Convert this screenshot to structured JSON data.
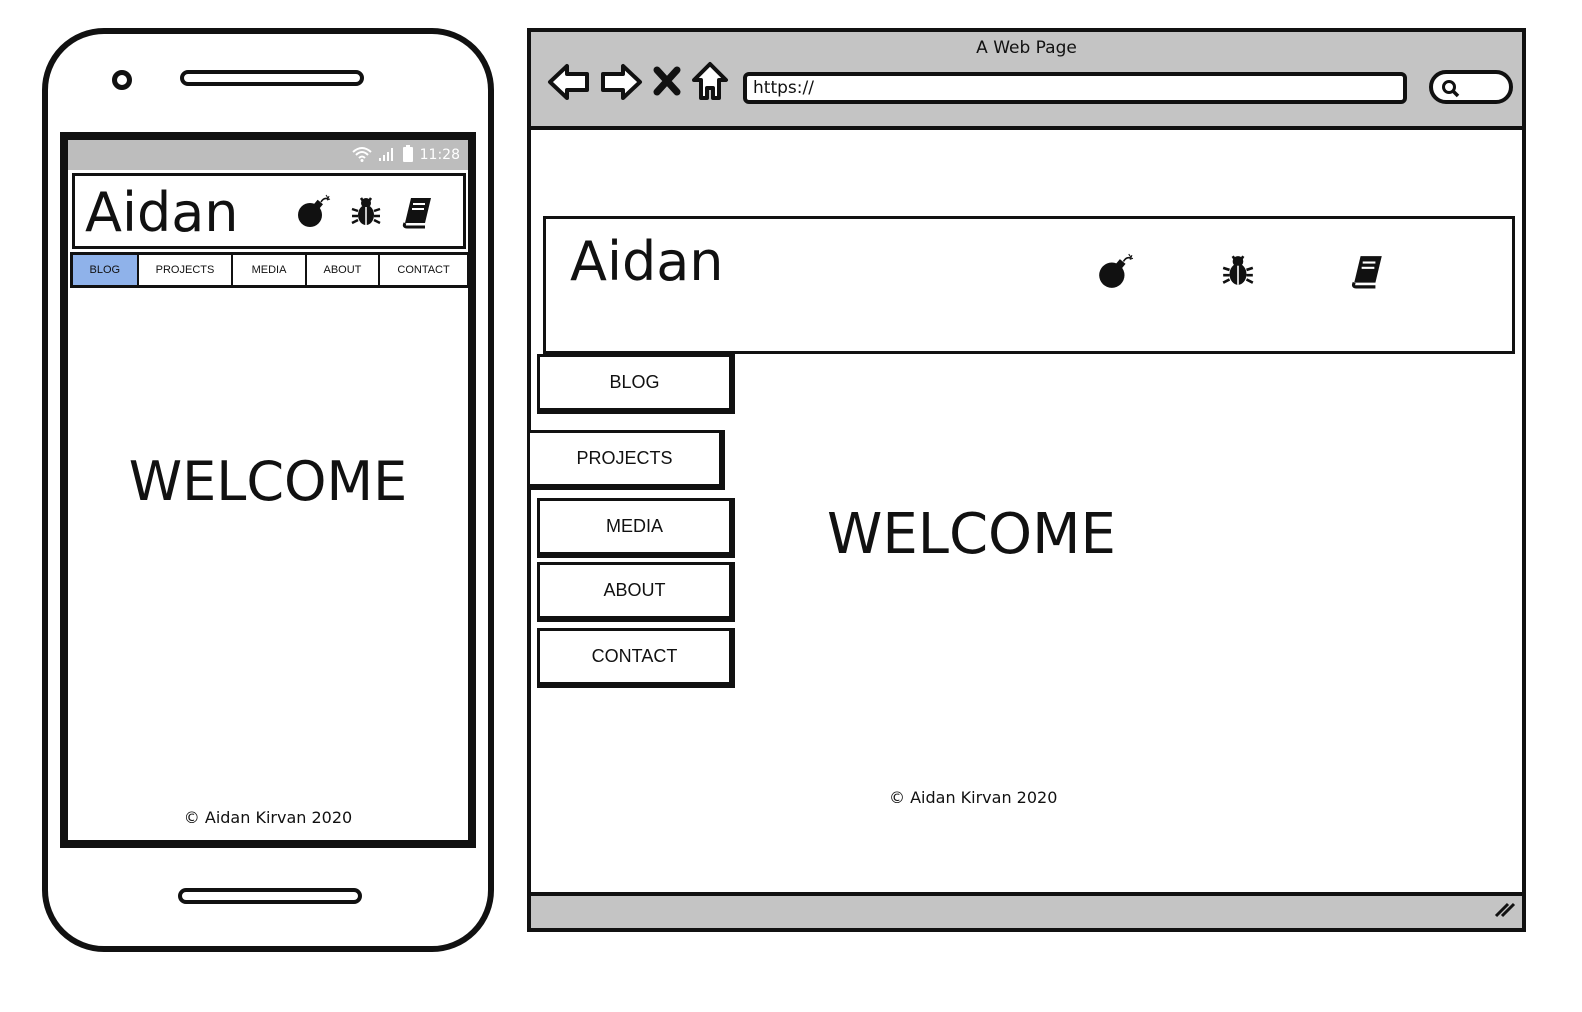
{
  "mobile": {
    "status": {
      "time": "11:28"
    },
    "logo": "Aidan",
    "icons": [
      "bomb-icon",
      "bug-icon",
      "book-icon"
    ],
    "nav": [
      "BLOG",
      "PROJECTS",
      "MEDIA",
      "ABOUT",
      "CONTACT"
    ],
    "active_nav": "BLOG",
    "welcome": "WELCOME",
    "footer": "© Aidan Kirvan 2020"
  },
  "browser": {
    "title": "A Web Page",
    "url": "https://",
    "logo": "Aidan",
    "icons": [
      "bomb-icon",
      "bug-icon",
      "book-icon"
    ],
    "nav": [
      "BLOG",
      "PROJECTS",
      "MEDIA",
      "ABOUT",
      "CONTACT"
    ],
    "welcome": "WELCOME",
    "footer": "© Aidan Kirvan 2020"
  },
  "colors": {
    "active_tab": "#8fb2ea",
    "chrome_gray": "#c4c4c4",
    "status_gray": "#bdbdbd",
    "ink": "#111111"
  }
}
